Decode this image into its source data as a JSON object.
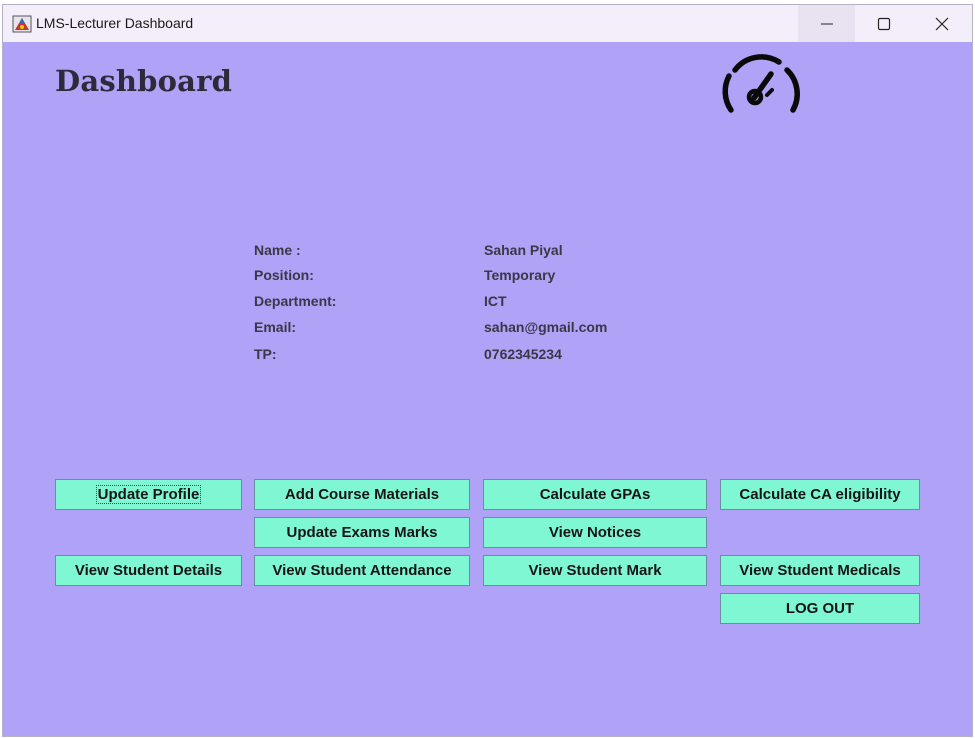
{
  "window": {
    "title": "LMS-Lecturer Dashboard"
  },
  "icons": {
    "app": "app-icon",
    "minimize": "minimize-icon",
    "maximize": "maximize-icon",
    "close": "close-icon",
    "dashboard": "speedometer-icon"
  },
  "page": {
    "title": "Dashboard"
  },
  "profile": {
    "name_label": "Name :",
    "name_value": "Sahan Piyal",
    "position_label": "Position:",
    "position_value": "Temporary",
    "department_label": "Department:",
    "department_value": "ICT",
    "email_label": "Email:",
    "email_value": "sahan@gmail.com",
    "tp_label": "TP:",
    "tp_value": "0762345234"
  },
  "buttons": {
    "update_profile": "Update Profile",
    "add_course_materials": "Add Course Materials",
    "calculate_gpas": "Calculate GPAs",
    "calculate_ca": "Calculate CA eligibility",
    "update_exam_marks": "Update Exams Marks",
    "view_notices": "View Notices",
    "view_student_details": "View Student Details",
    "view_student_attendance": "View Student Attendance",
    "view_student_mark": "View Student Mark",
    "view_student_medicals": "View Student Medicals",
    "logout": "LOG OUT"
  },
  "colors": {
    "background": "#b0a2f7",
    "button": "#7ff7d3",
    "titlebar": "#f3eef9"
  }
}
